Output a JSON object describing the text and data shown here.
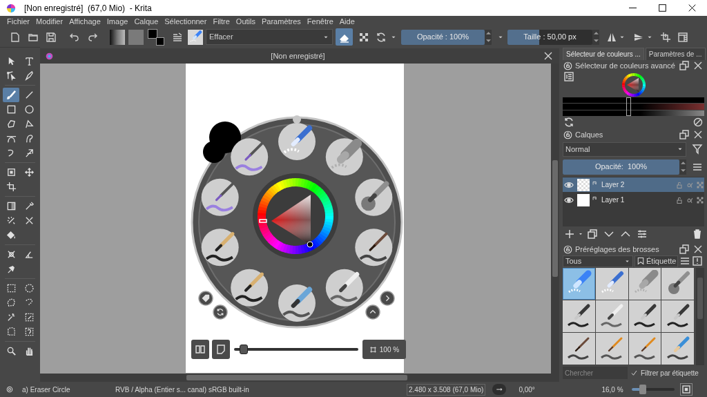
{
  "window": {
    "title": "[Non enregistré]  (67,0 Mio)  - Krita"
  },
  "menu": [
    "Fichier",
    "Modifier",
    "Affichage",
    "Image",
    "Calque",
    "Sélectionner",
    "Filtre",
    "Outils",
    "Paramètres",
    "Fenêtre",
    "Aide"
  ],
  "toolbar": {
    "preset_name": "Effacer",
    "eraser_mode": true,
    "opacity": {
      "label": "Opacité : 100%",
      "level": 1
    },
    "size": {
      "label": "Taille : 50,00 px",
      "level": 0.37
    }
  },
  "toolbox": [
    {
      "tools": [
        {
          "kind": "pointer",
          "selected": false
        },
        {
          "kind": "text",
          "selected": false
        },
        {
          "kind": "edit-shape",
          "selected": false
        },
        {
          "kind": "calligraphy",
          "selected": false
        }
      ]
    },
    {
      "tools": [
        {
          "kind": "brush",
          "selected": true
        },
        {
          "kind": "line",
          "selected": false
        },
        {
          "kind": "rectangle",
          "selected": false
        },
        {
          "kind": "ellipse",
          "selected": false
        },
        {
          "kind": "polygon",
          "selected": false
        },
        {
          "kind": "polyline",
          "selected": false
        },
        {
          "kind": "bezier",
          "selected": false
        },
        {
          "kind": "freehand-path",
          "selected": false
        },
        {
          "kind": "dynamic",
          "selected": false
        },
        {
          "kind": "multibrush",
          "selected": false
        }
      ]
    },
    {
      "tools": [
        {
          "kind": "transform",
          "selected": false
        },
        {
          "kind": "move",
          "selected": false
        },
        {
          "kind": "crop",
          "selected": false
        }
      ]
    },
    {
      "tools": [
        {
          "kind": "gradient",
          "selected": false
        },
        {
          "kind": "picker",
          "selected": false
        },
        {
          "kind": "smart-patch",
          "selected": false
        },
        {
          "kind": "colorize",
          "selected": false
        },
        {
          "kind": "fill",
          "selected": false
        }
      ]
    },
    {
      "tools": [
        {
          "kind": "assistant",
          "selected": false
        },
        {
          "kind": "measure",
          "selected": false
        },
        {
          "kind": "reference",
          "selected": false
        }
      ]
    },
    {
      "tools": [
        {
          "kind": "rect-select",
          "selected": false
        },
        {
          "kind": "ellipse-select",
          "selected": false
        },
        {
          "kind": "polygon-select",
          "selected": false
        },
        {
          "kind": "freehand-select",
          "selected": false
        },
        {
          "kind": "wand-select",
          "selected": false
        },
        {
          "kind": "color-select",
          "selected": false
        },
        {
          "kind": "bezier-select",
          "selected": false
        },
        {
          "kind": "magnetic-select",
          "selected": false
        }
      ]
    },
    {
      "tools": [
        {
          "kind": "zoom",
          "selected": false
        },
        {
          "kind": "pan",
          "selected": false
        }
      ]
    }
  ],
  "document": {
    "title": "[Non enregistré]"
  },
  "popup": {
    "slots": [
      {
        "kind": "marker-eraser"
      },
      {
        "kind": "soft-eraser"
      },
      {
        "kind": "airbrush"
      },
      {
        "kind": "brush"
      },
      {
        "kind": "ink-pen"
      },
      {
        "kind": "blender"
      },
      {
        "kind": "bristle"
      },
      {
        "kind": "bristle"
      },
      {
        "kind": "wet-brush"
      },
      {
        "kind": "wet-brush"
      }
    ],
    "slider": {
      "level": 0.05
    },
    "zoom": {
      "label": "100 %"
    }
  },
  "dock": {
    "tabs": [
      {
        "label": "Sélecteur de couleurs ...",
        "selected": true
      },
      {
        "label": "Paramètres de ...",
        "selected": false
      }
    ],
    "color_selector": {
      "title": "Sélecteur de couleurs avancé"
    },
    "layers": {
      "title": "Calques",
      "blend_mode": "Normal",
      "opacity": {
        "label": "Opacité:  100%",
        "level": 1
      },
      "items": [
        {
          "name": "Layer 2",
          "selected": true,
          "visible": true,
          "transparent": true
        },
        {
          "name": "Layer 1",
          "selected": false,
          "visible": true,
          "transparent": false
        }
      ]
    },
    "presets": {
      "title": "Préréglages des brosses",
      "tag_filter": "Tous",
      "tag_button": "Étiquette",
      "items": [
        {
          "kind": "eraser",
          "selected": true
        },
        {
          "kind": "marker-eraser",
          "selected": false
        },
        {
          "kind": "soft-eraser",
          "selected": false
        },
        {
          "kind": "airbrush",
          "selected": false
        },
        {
          "kind": "pen",
          "selected": false
        },
        {
          "kind": "ink-pen",
          "selected": false
        },
        {
          "kind": "pen",
          "selected": false
        },
        {
          "kind": "pen",
          "selected": false
        },
        {
          "kind": "brush",
          "selected": false
        },
        {
          "kind": "orange-brush",
          "selected": false
        },
        {
          "kind": "orange-brush",
          "selected": false
        },
        {
          "kind": "pencil",
          "selected": false
        }
      ],
      "search": {
        "placeholder": "Chercher"
      },
      "filter_by_tag": {
        "label": "Filtrer par étiquette",
        "checked": true
      }
    }
  },
  "status_bar": {
    "brush": "a) Eraser Circle",
    "color_space": "RVB / Alpha (Entier s... canal) sRGB built-in",
    "dimensions": "2.480 x 3.508 (67,0 Mio)",
    "rotation": "0,00°",
    "zoom": {
      "label": "16,0 %",
      "level": 0.2
    }
  }
}
